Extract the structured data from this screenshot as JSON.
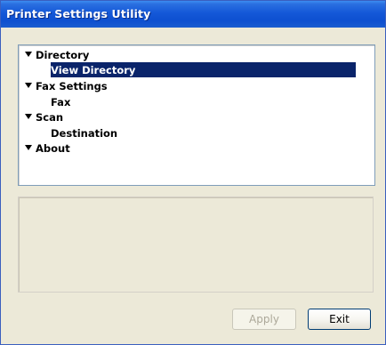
{
  "window": {
    "title": "Printer Settings Utility"
  },
  "tree": {
    "items": [
      {
        "label": "Directory",
        "level": 0,
        "expanded": true
      },
      {
        "label": "View Directory",
        "level": 1,
        "selected": true
      },
      {
        "label": "Fax Settings",
        "level": 0,
        "expanded": true
      },
      {
        "label": "Fax",
        "level": 1
      },
      {
        "label": "Scan",
        "level": 0,
        "expanded": true
      },
      {
        "label": "Destination",
        "level": 1
      },
      {
        "label": "About",
        "level": 0,
        "expanded": true
      }
    ]
  },
  "buttons": {
    "apply_label": "Apply",
    "apply_enabled": false,
    "exit_label": "Exit"
  },
  "colors": {
    "titlebar": "#0d4fd0",
    "selection": "#0a246a",
    "window_bg": "#ece9d8"
  }
}
